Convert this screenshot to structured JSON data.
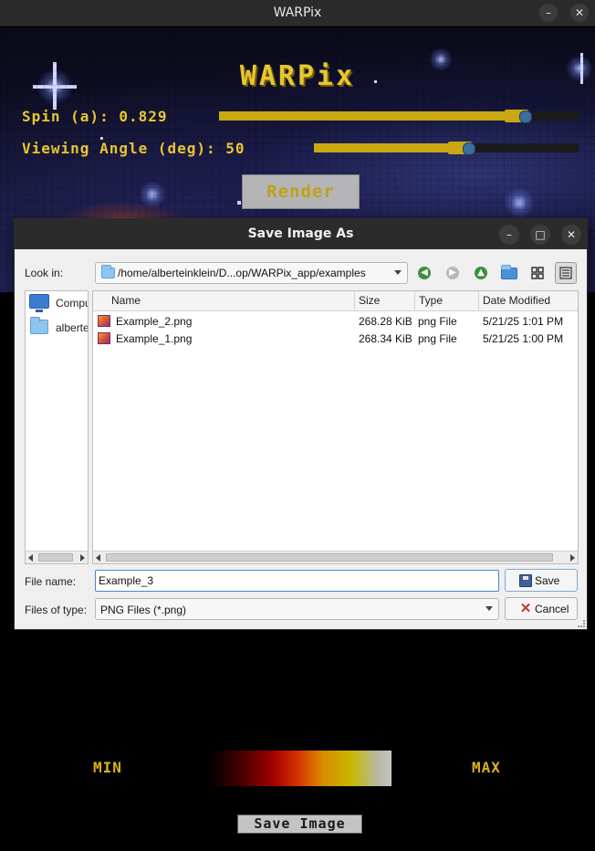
{
  "app": {
    "window_title": "WARPix",
    "heading": "WARPix",
    "spin_label": "Spin (a): 0.829",
    "spin_value": 0.829,
    "angle_label": "Viewing Angle (deg): 50",
    "angle_value": 50,
    "render_label": "Render",
    "range_min_label": "MIN",
    "range_max_label": "MAX",
    "save_image_label": "Save Image",
    "accent_color": "#e8c630"
  },
  "dialog": {
    "title": "Save Image As",
    "look_in_label": "Look in:",
    "look_in_path": "/home/alberteinklein/D...op/WARPix_app/examples",
    "sidebar": {
      "items": [
        {
          "label": "Computer",
          "icon": "computer-icon"
        },
        {
          "label": "alberteinklein",
          "icon": "folder-icon"
        }
      ]
    },
    "columns": [
      "Name",
      "Size",
      "Type",
      "Date Modified"
    ],
    "files": [
      {
        "name": "Example_2.png",
        "size": "268.28 KiB",
        "type": "png File",
        "modified": "5/21/25 1:01 PM"
      },
      {
        "name": "Example_1.png",
        "size": "268.34 KiB",
        "type": "png File",
        "modified": "5/21/25 1:00 PM"
      }
    ],
    "file_name_label": "File name:",
    "file_name_value": "Example_3",
    "files_of_type_label": "Files of type:",
    "file_type_value": "PNG Files (*.png)",
    "save_label": "Save",
    "cancel_label": "Cancel"
  }
}
